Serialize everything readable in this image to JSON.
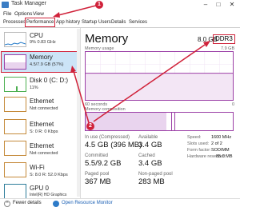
{
  "window": {
    "title": "Task Manager",
    "controls": [
      "–",
      "□",
      "✕"
    ]
  },
  "menu": [
    "File",
    "Options",
    "View"
  ],
  "tabs": [
    "Processes",
    "Performance",
    "App history",
    "Startup",
    "Users",
    "Details",
    "Services"
  ],
  "sidebar": {
    "items": [
      {
        "label": "CPU",
        "sub": "9% 0.83 GHz"
      },
      {
        "label": "Memory",
        "sub": "4.5/7.9 GB (57%)"
      },
      {
        "label": "Disk 0 (C: D:)",
        "sub": "11%"
      },
      {
        "label": "Ethernet",
        "sub": "Not connected"
      },
      {
        "label": "Ethernet",
        "sub": "S: 0 R: 0 Kbps"
      },
      {
        "label": "Ethernet",
        "sub": "Not connected"
      },
      {
        "label": "Wi-Fi",
        "sub": "S: 8.0 R: 52.0 Kbps"
      },
      {
        "label": "GPU 0",
        "sub": "Intel(R) HD Graphics"
      }
    ]
  },
  "memory": {
    "title": "Memory",
    "total": "8.0 GB",
    "type": "DDR3",
    "usage_label": "Memory usage",
    "usage_max": "7.9 GB",
    "x_left": "60 seconds",
    "x_right": "0",
    "composition_label": "Memory composition",
    "usage_fraction": 0.57
  },
  "stats": {
    "in_use_label": "In use (Compressed)",
    "in_use_value": "4.5 GB (396 MB)",
    "available_label": "Available",
    "available_value": "3.4 GB",
    "committed_label": "Committed",
    "committed_value": "5.5/9.2 GB",
    "cached_label": "Cached",
    "cached_value": "3.4 GB",
    "paged_label": "Paged pool",
    "paged_value": "367 MB",
    "nonpaged_label": "Non-paged pool",
    "nonpaged_value": "283 MB"
  },
  "specs": [
    {
      "label": "Speed:",
      "value": "1600 MHz"
    },
    {
      "label": "Slots used:",
      "value": "2 of 2"
    },
    {
      "label": "Form factor:",
      "value": "SODIMM"
    },
    {
      "label": "Hardware reserved:",
      "value": "85.0 MB"
    }
  ],
  "footer": {
    "fewer_details": "Fewer details",
    "open_monitor": "Open Resource Monitor"
  },
  "annotations": [
    "1",
    "2"
  ],
  "colors": {
    "accent_memory": "#9b3fa6",
    "annotation_red": "#d0223a",
    "selection": "#cce4f7"
  }
}
